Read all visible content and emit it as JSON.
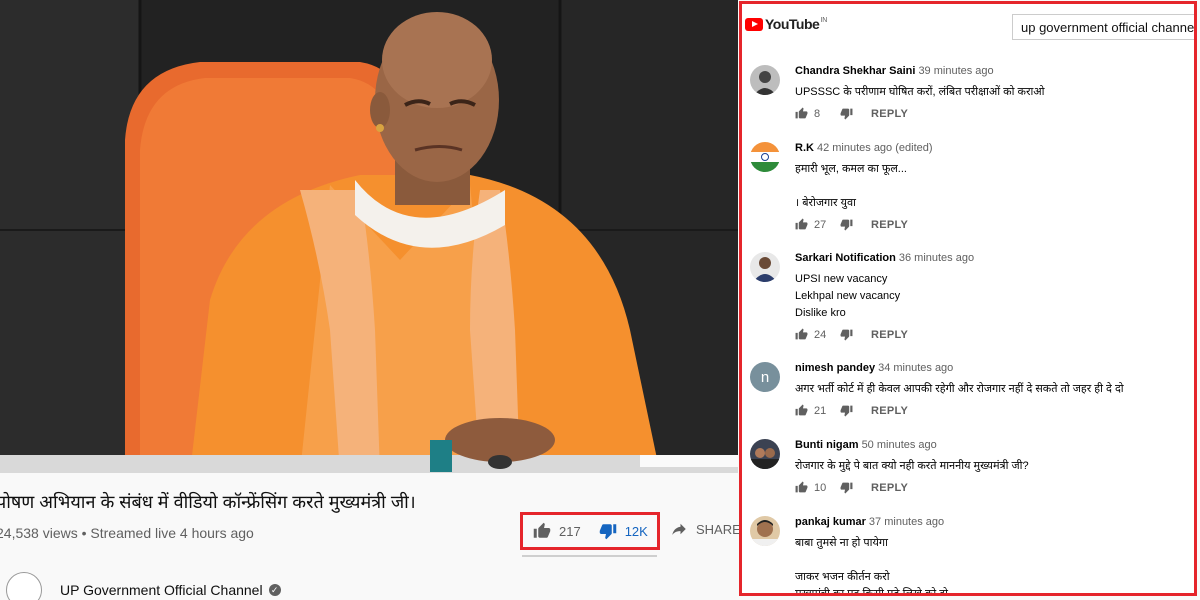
{
  "video": {
    "title": "पोषण अभियान के संबंध में वीडियो कॉन्फ्रेंसिंग करते मुख्यमंत्री जी।",
    "views": "24,538 views",
    "separator": "•",
    "streamed": "Streamed live 4 hours ago",
    "likes": "217",
    "dislikes": "12K",
    "share_label": "SHARE",
    "channel_name": "UP Government Official Channel"
  },
  "youtube_panel": {
    "logo_text": "YouTube",
    "region": "IN",
    "search_value": "up government official channel",
    "comments": [
      {
        "author": "Chandra Shekhar Saini",
        "time": "39 minutes ago",
        "text": "UPSSSC के  परीणाम घोषित करों, लंबित परीक्षाओं को कराओ",
        "likes": "8",
        "reply": "REPLY",
        "avatar": "photo-dark"
      },
      {
        "author": "R.K",
        "time": "42 minutes ago (edited)",
        "text": "हमारी भूल, कमल का फूल...\n\n। बेरोजगार युवा",
        "likes": "27",
        "reply": "REPLY",
        "avatar": "flag-india"
      },
      {
        "author": "Sarkari Notification",
        "time": "36 minutes ago",
        "text": "UPSI new vacancy\nLekhpal new vacancy\nDislike kro",
        "likes": "24",
        "reply": "REPLY",
        "avatar": "photo-person"
      },
      {
        "author": "nimesh pandey",
        "time": "34 minutes ago",
        "text": "अगर भर्ती कोर्ट में ही केवल आपकी रहेगी और रोजगार नहीं दे सकते तो जहर ही दे दो",
        "likes": "21",
        "reply": "REPLY",
        "avatar": "letter-n",
        "avatar_letter": "n"
      },
      {
        "author": "Bunti nigam",
        "time": "50 minutes ago",
        "text": "रोजगार के मुद्दे पे बात क्यो नही करते माननीय मुख्यमंत्री जी?",
        "likes": "10",
        "reply": "REPLY",
        "avatar": "photo-group"
      },
      {
        "author": "pankaj kumar",
        "time": "37 minutes ago",
        "text": "बाबा तुमसे ना हो पायेगा\n\nजाकर भजन कीर्तन करो\nमुख्यमंत्री का पद किसी पढ़े लिखे को दो",
        "likes": "",
        "reply": "",
        "avatar": "photo-face"
      }
    ]
  },
  "colors": {
    "highlight": "#e5252b",
    "dislike_blue": "#1565c0",
    "youtube_red": "#ff0000",
    "robe_orange": "#f5902e"
  }
}
